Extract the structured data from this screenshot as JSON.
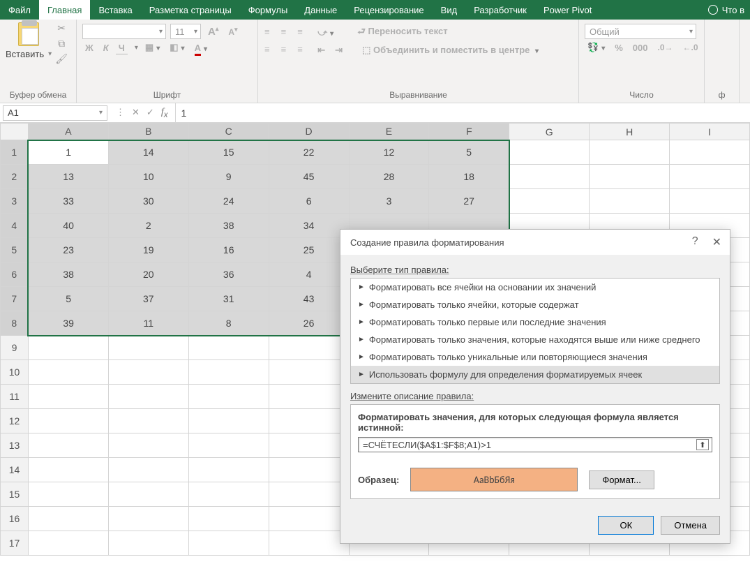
{
  "tabs": [
    "Файл",
    "Главная",
    "Вставка",
    "Разметка страницы",
    "Формулы",
    "Данные",
    "Рецензирование",
    "Вид",
    "Разработчик",
    "Power Pivot"
  ],
  "active_tab_index": 1,
  "tell_me": "Что в",
  "ribbon": {
    "clipboard": {
      "paste": "Вставить",
      "group": "Буфер обмена"
    },
    "font": {
      "font_name": "",
      "font_size": "11",
      "bold": "Ж",
      "italic": "К",
      "underline": "Ч",
      "increase": "A",
      "decrease": "A",
      "group": "Шрифт"
    },
    "align": {
      "wrap": "Переносить текст",
      "merge": "Объединить и поместить в центре",
      "group": "Выравнивание"
    },
    "number": {
      "format": "Общий",
      "group": "Число"
    },
    "last_group": "ф"
  },
  "namebox": "A1",
  "formula_value": "1",
  "columns": [
    "A",
    "B",
    "C",
    "D",
    "E",
    "F",
    "G",
    "H",
    "I"
  ],
  "rows": [
    1,
    2,
    3,
    4,
    5,
    6,
    7,
    8,
    9,
    10,
    11,
    12,
    13,
    14,
    15,
    16,
    17
  ],
  "grid": [
    [
      1,
      14,
      15,
      22,
      12,
      5
    ],
    [
      13,
      10,
      9,
      45,
      28,
      18
    ],
    [
      33,
      30,
      24,
      6,
      3,
      27
    ],
    [
      40,
      2,
      38,
      34,
      null,
      null
    ],
    [
      23,
      19,
      16,
      25,
      null,
      null
    ],
    [
      38,
      20,
      36,
      4,
      null,
      null
    ],
    [
      5,
      37,
      31,
      43,
      null,
      null
    ],
    [
      39,
      11,
      8,
      26,
      null,
      null
    ]
  ],
  "dialog": {
    "title": "Создание правила форматирования",
    "select_label": "Выберите тип правила:",
    "rules": [
      "Форматировать все ячейки на основании их значений",
      "Форматировать только ячейки, которые содержат",
      "Форматировать только первые или последние значения",
      "Форматировать только значения, которые находятся выше или ниже среднего",
      "Форматировать только уникальные или повторяющиеся значения",
      "Использовать формулу для определения форматируемых ячеек"
    ],
    "selected_rule_index": 5,
    "edit_label": "Измените описание правила:",
    "formula_label": "Форматировать значения, для которых следующая формула является истинной:",
    "formula_value": "=СЧЁТЕСЛИ($A$1:$F$8;A1)>1",
    "preview_label": "Образец:",
    "preview_text": "АаВbБбЯя",
    "format_btn": "Формат...",
    "ok": "ОК",
    "cancel": "Отмена"
  }
}
